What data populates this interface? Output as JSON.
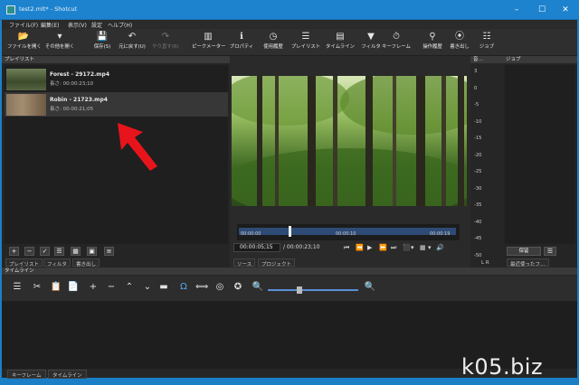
{
  "window": {
    "title": "test2.mlt* - Shotcut",
    "minimize": "–",
    "maximize": "☐",
    "close": "✕"
  },
  "menu": [
    "ファイル(F)",
    "編集(E)",
    "表示(V)",
    "設定",
    "ヘルプ(H)"
  ],
  "toolbar": [
    {
      "label": "ファイルを開く",
      "icon": "📂",
      "disabled": false
    },
    {
      "label": "その他を開く",
      "icon": "▾",
      "disabled": false
    },
    {
      "label": "保存(S)",
      "icon": "💾",
      "disabled": false
    },
    {
      "label": "元に戻す(U)",
      "icon": "↶",
      "disabled": false
    },
    {
      "label": "やり直す(R)",
      "icon": "↷",
      "disabled": true
    },
    {
      "label": "ピークメーター",
      "icon": "▥",
      "disabled": false
    },
    {
      "label": "プロパティ",
      "icon": "ℹ",
      "disabled": false
    },
    {
      "label": "使用履歴",
      "icon": "◷",
      "disabled": false
    },
    {
      "label": "プレイリスト",
      "icon": "☰",
      "disabled": false
    },
    {
      "label": "タイムライン",
      "icon": "▤",
      "disabled": false
    },
    {
      "label": "フィルタ",
      "icon": "▼",
      "disabled": false
    },
    {
      "label": "キーフレーム",
      "icon": "⏱",
      "disabled": false
    },
    {
      "label": "操作履歴",
      "icon": "⚲",
      "disabled": false
    },
    {
      "label": "書き出し",
      "icon": "⦿",
      "disabled": false
    },
    {
      "label": "ジョブ",
      "icon": "☷",
      "disabled": false
    }
  ],
  "playlist": {
    "title": "プレイリスト",
    "items": [
      {
        "name": "Forest - 29172.mp4",
        "duration": "長さ: 00:00:23;10"
      },
      {
        "name": "Robin - 21723.mp4",
        "duration": "長さ: 00:00:21;05"
      }
    ],
    "buttons": [
      "+",
      "−",
      "✓",
      "☰",
      "▦",
      "▣",
      "≡"
    ],
    "tabs": [
      "プレイリスト",
      "フィルタ",
      "書き出し"
    ]
  },
  "viewer": {
    "timecode": "00:00:05;15",
    "duration": "/ 00:00:23;10",
    "ticks": [
      "00:00:00",
      "00:00:10",
      "00:00:19"
    ],
    "transport": [
      "⏮",
      "⏪",
      "▶",
      "⏩",
      "⏭",
      "⬛",
      "▾",
      "▦",
      "▾",
      "🔊"
    ],
    "tabs": [
      "ソース",
      "プロジェクト"
    ],
    "playhead_fraction": 0.23
  },
  "audio": {
    "title": "音…",
    "scale": [
      "3",
      "0",
      "-5",
      "-10",
      "-15",
      "-20",
      "-25",
      "-30",
      "-35",
      "-40",
      "-45",
      "-50"
    ],
    "channels": "L R"
  },
  "jobs": {
    "title": "ジョブ",
    "pause": "保留",
    "menu": "☰",
    "recent": "最近使ったフ…"
  },
  "timeline": {
    "title": "タイムライン",
    "tools": [
      "☰",
      "✂",
      "📋",
      "📄",
      "+",
      "−",
      "⌃",
      "⌄",
      "▬",
      "Ω",
      "⟺",
      "◎",
      "✪",
      "🔍",
      "🔍"
    ],
    "active_tool": 9
  },
  "bottom_tabs": [
    "キーフレーム",
    "タイムライン"
  ],
  "watermark": "k05.biz",
  "colors": {
    "accent": "#1e83cf",
    "panel": "#252525",
    "highlight": "#5aa7ea",
    "arrow": "#e8141c"
  }
}
